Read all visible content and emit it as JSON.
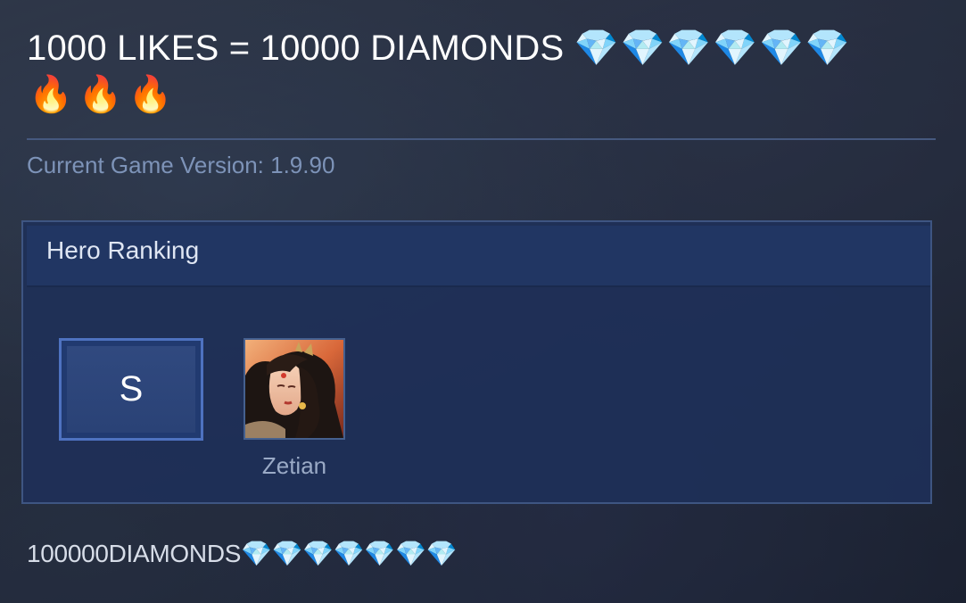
{
  "post": {
    "title": "1000 LIKES = 10000 DIAMONDS",
    "title_gems": "💎💎💎💎💎💎",
    "fires": "🔥🔥🔥",
    "version": "Current Game Version: 1.9.90",
    "footer": "100000DIAMONDS💎💎💎💎💎💎💎"
  },
  "ranking": {
    "header": "Hero Ranking",
    "tier": "S",
    "heroes": [
      {
        "name": "Zetian",
        "icon": "hero-portrait-zetian"
      }
    ]
  },
  "colors": {
    "panel": "#1e3058",
    "panel_border": "#3e5582",
    "tier_border": "#4e72c0",
    "version_text": "#7d93b8",
    "divider": "#46597f"
  }
}
